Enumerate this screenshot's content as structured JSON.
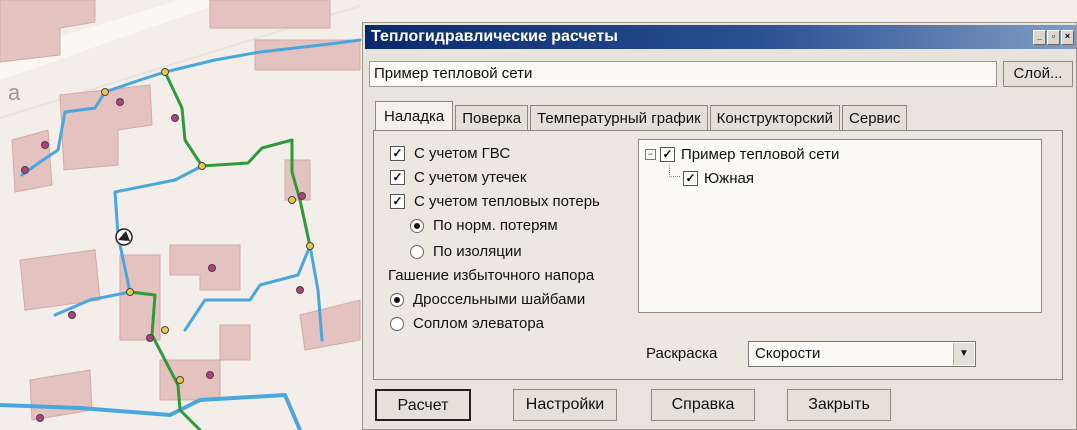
{
  "map": {
    "street_label": "a",
    "colors": {
      "background": "#f3eeea",
      "building": "#e4c2c0",
      "pipe_blue": "#4aa6dc",
      "pipe_green": "#2f9a3a",
      "node_fill": "#b04080",
      "valve_fill": "#e8c94a"
    },
    "icons": [
      "pump-icon"
    ]
  },
  "dialog": {
    "title": "Теплогидравлические расчеты",
    "window_buttons": [
      "_",
      "▫",
      "×"
    ],
    "network_select": "Пример тепловой сети",
    "layer_button": "Слой...",
    "tabs": [
      {
        "label": "Наладка",
        "active": true
      },
      {
        "label": "Поверка",
        "active": false
      },
      {
        "label": "Температурный график",
        "active": false
      },
      {
        "label": "Конструкторский",
        "active": false
      },
      {
        "label": "Сервис",
        "active": false
      }
    ],
    "options": {
      "gvs": {
        "label": "С учетом ГВС",
        "checked": true
      },
      "leaks": {
        "label": "С учетом утечек",
        "checked": true
      },
      "heat_losses": {
        "label": "С учетом тепловых потерь",
        "checked": true
      },
      "norm_losses": {
        "label": "По норм. потерям",
        "selected": true
      },
      "insulation": {
        "label": "По изоляции",
        "selected": false
      },
      "pressure_heading": "Гашение избыточного напора",
      "throttle": {
        "label": "Дроссельными шайбами",
        "selected": true
      },
      "nozzle": {
        "label": "Соплом элеватора",
        "selected": false
      }
    },
    "tree": {
      "root": {
        "label": "Пример тепловой сети",
        "checked": true,
        "expander": "−"
      },
      "child": {
        "label": "Южная",
        "checked": true
      }
    },
    "coloring": {
      "label": "Раскраска",
      "value": "Скорости"
    },
    "buttons": {
      "calc": "Расчет",
      "settings": "Настройки",
      "help": "Справка",
      "close": "Закрыть"
    },
    "colors": {
      "title_bar": "#0a2a6e",
      "dialog_bg": "#e8e4dd"
    }
  }
}
